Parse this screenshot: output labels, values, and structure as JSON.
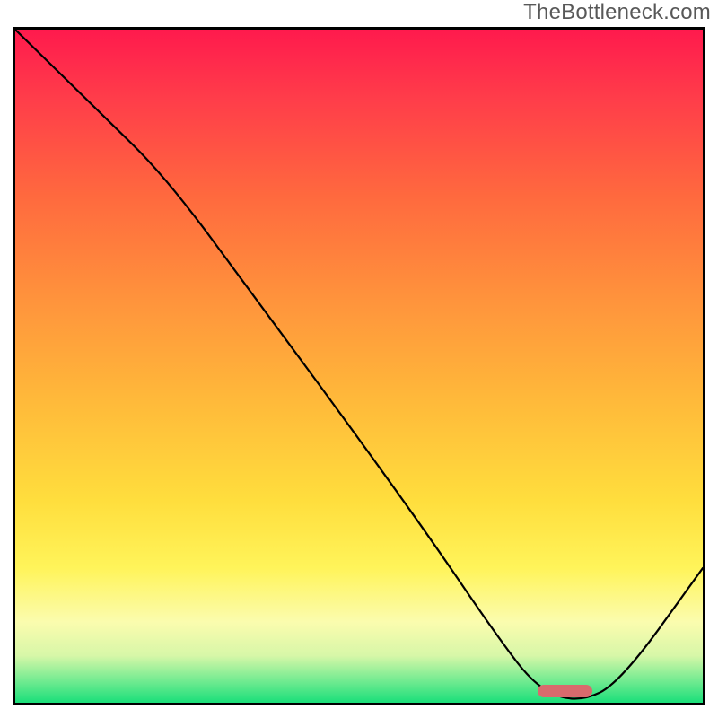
{
  "watermark": "TheBottleneck.com",
  "chart_data": {
    "type": "line",
    "title": "",
    "xlabel": "",
    "ylabel": "",
    "xlim": [
      0,
      100
    ],
    "ylim": [
      0,
      100
    ],
    "grid": false,
    "legend": false,
    "series": [
      {
        "name": "bottleneck-curve",
        "x": [
          0,
          12,
          22,
          35,
          48,
          60,
          70,
          76,
          82,
          88,
          100
        ],
        "y": [
          100,
          88,
          78,
          60,
          42,
          25,
          10,
          2,
          0,
          3,
          20
        ]
      }
    ],
    "marker": {
      "x_start": 76,
      "x_end": 84,
      "y": 0,
      "color": "#d96a6d"
    },
    "background_gradient": {
      "stops": [
        {
          "pos": 0.0,
          "color": "#ff1a4d"
        },
        {
          "pos": 0.25,
          "color": "#ff6a3e"
        },
        {
          "pos": 0.55,
          "color": "#ffb93a"
        },
        {
          "pos": 0.8,
          "color": "#fff45a"
        },
        {
          "pos": 0.93,
          "color": "#d7f7a8"
        },
        {
          "pos": 1.0,
          "color": "#1adf7a"
        }
      ]
    }
  }
}
